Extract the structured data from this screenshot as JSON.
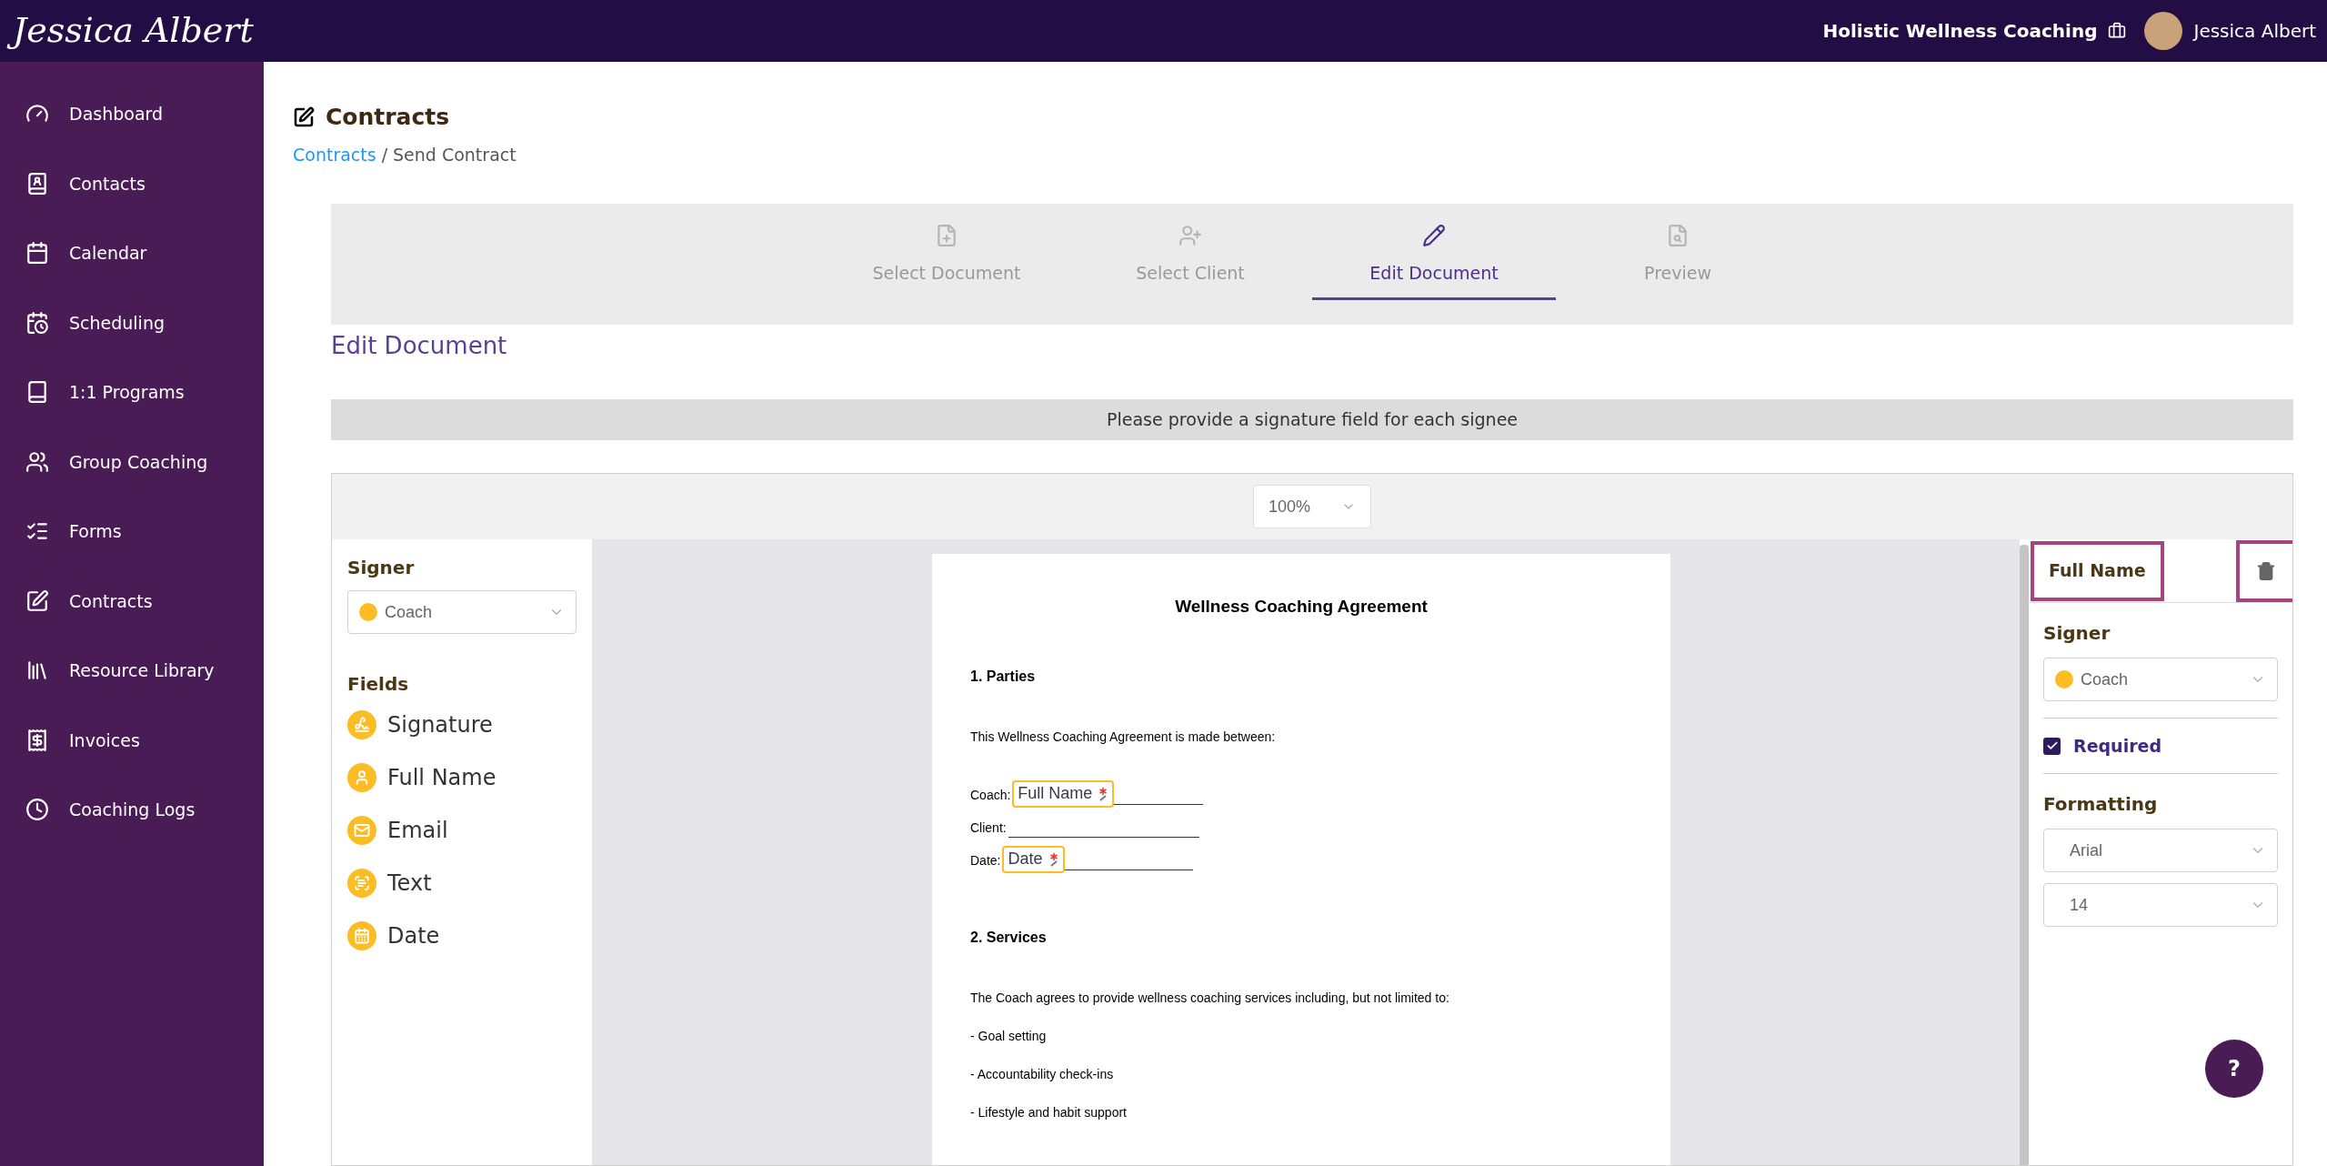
{
  "header": {
    "logo": "Jessica Albert",
    "org_name": "Holistic Wellness Coaching",
    "user_name": "Jessica Albert"
  },
  "sidebar": {
    "items": [
      {
        "label": "Dashboard"
      },
      {
        "label": "Contacts"
      },
      {
        "label": "Calendar"
      },
      {
        "label": "Scheduling"
      },
      {
        "label": "1:1 Programs"
      },
      {
        "label": "Group Coaching"
      },
      {
        "label": "Forms"
      },
      {
        "label": "Contracts"
      },
      {
        "label": "Resource Library"
      },
      {
        "label": "Invoices"
      },
      {
        "label": "Coaching Logs"
      }
    ]
  },
  "page": {
    "title": "Contracts",
    "breadcrumb_separator": "/",
    "breadcrumb": [
      {
        "label": "Contracts",
        "kind": "link"
      },
      {
        "label": "Send Contract",
        "kind": "current"
      }
    ]
  },
  "stepper": {
    "steps": [
      {
        "label": "Select Document",
        "selected": false
      },
      {
        "label": "Select Client",
        "selected": false
      },
      {
        "label": "Edit Document",
        "selected": true
      },
      {
        "label": "Preview",
        "selected": false
      }
    ]
  },
  "section_title": "Edit Document",
  "notice": "Please provide a signature field for each signee",
  "editor": {
    "zoom": "100%",
    "left": {
      "signer_label": "Signer",
      "signer": {
        "value": "Coach",
        "color": "#fbbc24"
      },
      "fields_label": "Fields",
      "fields": [
        {
          "label": "Signature",
          "kind": "signature"
        },
        {
          "label": "Full Name",
          "kind": "name"
        },
        {
          "label": "Email",
          "kind": "email"
        },
        {
          "label": "Text",
          "kind": "text"
        },
        {
          "label": "Date",
          "kind": "date"
        }
      ]
    },
    "document": {
      "title": "Wellness Coaching Agreement",
      "blocks": [
        {
          "kind": "heading",
          "text": "1. Parties"
        },
        {
          "kind": "paragraph",
          "text": "This Wellness Coaching Agreement is made between:"
        },
        {
          "kind": "line",
          "text": "Coach:",
          "field": {
            "label": "Full Name",
            "required": true
          }
        },
        {
          "kind": "line",
          "text": "Client:"
        },
        {
          "kind": "line",
          "text": "Date:",
          "field": {
            "label": "Date",
            "required": true
          }
        },
        {
          "kind": "heading",
          "text": "2. Services"
        },
        {
          "kind": "paragraph",
          "text": "The Coach agrees to provide wellness coaching services including, but not limited to:"
        },
        {
          "kind": "paragraph",
          "text": "- Goal setting"
        },
        {
          "kind": "paragraph",
          "text": "- Accountability check-ins"
        },
        {
          "kind": "paragraph",
          "text": "- Lifestyle and habit support"
        }
      ]
    },
    "right": {
      "title": "Full Name",
      "signer_label": "Signer",
      "signer": {
        "value": "Coach",
        "color": "#fbbc24"
      },
      "required": {
        "label": "Required",
        "checked": true
      },
      "formatting_label": "Formatting",
      "font": "Arial",
      "size": "14"
    }
  },
  "help": "?"
}
